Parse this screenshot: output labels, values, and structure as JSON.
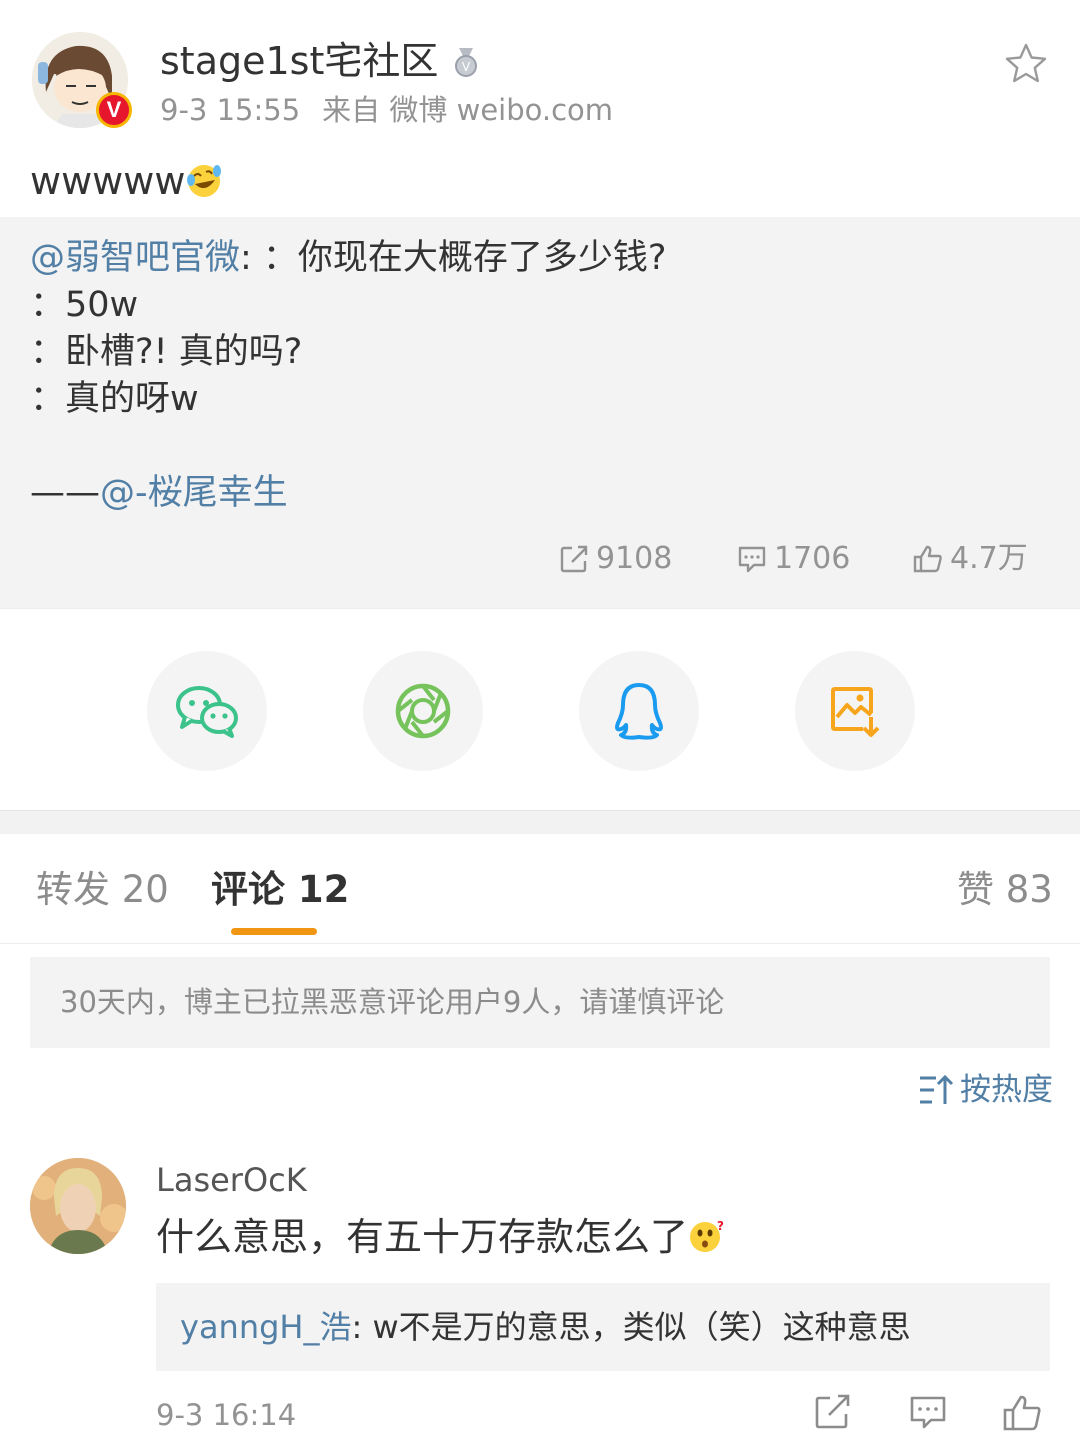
{
  "post": {
    "author": "stage1st宅社区",
    "time": "9-3 15:55",
    "source": "来自 微博 weibo.com",
    "text": "wwwww",
    "text_emoji": "laugh-cry-emoji"
  },
  "repost": {
    "mention": "@弱智吧官微",
    "first_line_rest": ": ：你现在大概存了多少钱?",
    "lines": [
      "：50w",
      "：卧槽?! 真的吗?",
      "：真的呀w"
    ],
    "credit_prefix": "——",
    "credit_mention": "@-桜尾幸生",
    "stats": {
      "reposts": "9108",
      "comments": "1706",
      "likes": "4.7万"
    }
  },
  "share": {
    "icons": [
      "wechat-icon",
      "moments-icon",
      "qq-icon",
      "save-image-icon"
    ],
    "colors": {
      "wechat": "#3cc28b",
      "moments": "#76c35b",
      "qq": "#1a9bf0",
      "save": "#f7a51c"
    }
  },
  "tabs": {
    "reposts_label": "转发 20",
    "comments_label": "评论 12",
    "likes_label": "赞 83",
    "active": "comments",
    "accent": "#f09612"
  },
  "notice": "30天内，博主已拉黑恶意评论用户9人，请谨慎评论",
  "sort_label": "按热度",
  "comments": [
    {
      "user": "LaserOcK",
      "text": "什么意思，有五十万存款怎么了",
      "text_emoji": "surprised-emoji",
      "reply_user": "yanngH_浩",
      "reply_text": ": w不是万的意思，类似（笑）这种意思",
      "time": "9-3 16:14"
    }
  ]
}
